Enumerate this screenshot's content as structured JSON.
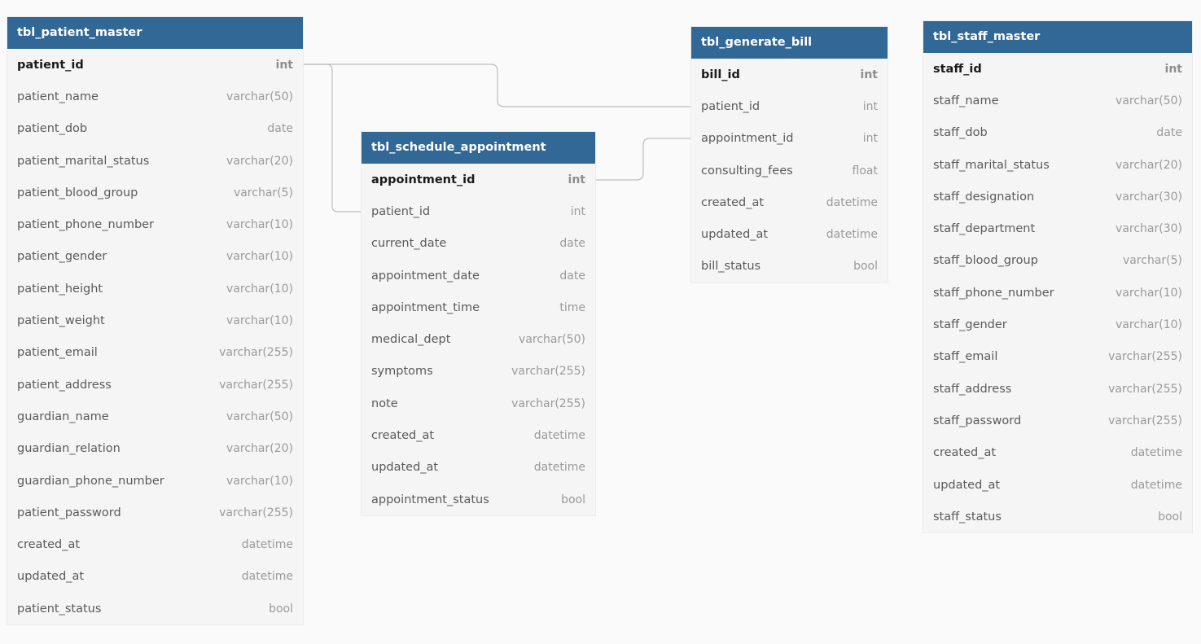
{
  "tables": {
    "patient": {
      "name": "tbl_patient_master",
      "columns": [
        {
          "name": "patient_id",
          "type": "int",
          "pk": true
        },
        {
          "name": "patient_name",
          "type": "varchar(50)"
        },
        {
          "name": "patient_dob",
          "type": "date"
        },
        {
          "name": "patient_marital_status",
          "type": "varchar(20)"
        },
        {
          "name": "patient_blood_group",
          "type": "varchar(5)"
        },
        {
          "name": "patient_phone_number",
          "type": "varchar(10)"
        },
        {
          "name": "patient_gender",
          "type": "varchar(10)"
        },
        {
          "name": "patient_height",
          "type": "varchar(10)"
        },
        {
          "name": "patient_weight",
          "type": "varchar(10)"
        },
        {
          "name": "patient_email",
          "type": "varchar(255)"
        },
        {
          "name": "patient_address",
          "type": "varchar(255)"
        },
        {
          "name": "guardian_name",
          "type": "varchar(50)"
        },
        {
          "name": "guardian_relation",
          "type": "varchar(20)"
        },
        {
          "name": "guardian_phone_number",
          "type": "varchar(10)"
        },
        {
          "name": "patient_password",
          "type": "varchar(255)"
        },
        {
          "name": "created_at",
          "type": "datetime"
        },
        {
          "name": "updated_at",
          "type": "datetime"
        },
        {
          "name": "patient_status",
          "type": "bool"
        }
      ]
    },
    "appointment": {
      "name": "tbl_schedule_appointment",
      "columns": [
        {
          "name": "appointment_id",
          "type": "int",
          "pk": true
        },
        {
          "name": "patient_id",
          "type": "int"
        },
        {
          "name": "current_date",
          "type": "date"
        },
        {
          "name": "appointment_date",
          "type": "date"
        },
        {
          "name": "appointment_time",
          "type": "time"
        },
        {
          "name": "medical_dept",
          "type": "varchar(50)"
        },
        {
          "name": "symptoms",
          "type": "varchar(255)"
        },
        {
          "name": "note",
          "type": "varchar(255)"
        },
        {
          "name": "created_at",
          "type": "datetime"
        },
        {
          "name": "updated_at",
          "type": "datetime"
        },
        {
          "name": "appointment_status",
          "type": "bool"
        }
      ]
    },
    "bill": {
      "name": "tbl_generate_bill",
      "columns": [
        {
          "name": "bill_id",
          "type": "int",
          "pk": true
        },
        {
          "name": "patient_id",
          "type": "int"
        },
        {
          "name": "appointment_id",
          "type": "int"
        },
        {
          "name": "consulting_fees",
          "type": "float"
        },
        {
          "name": "created_at",
          "type": "datetime"
        },
        {
          "name": "updated_at",
          "type": "datetime"
        },
        {
          "name": "bill_status",
          "type": "bool"
        }
      ]
    },
    "staff": {
      "name": "tbl_staff_master",
      "columns": [
        {
          "name": "staff_id",
          "type": "int",
          "pk": true
        },
        {
          "name": "staff_name",
          "type": "varchar(50)"
        },
        {
          "name": "staff_dob",
          "type": "date"
        },
        {
          "name": "staff_marital_status",
          "type": "varchar(20)"
        },
        {
          "name": "staff_designation",
          "type": "varchar(30)"
        },
        {
          "name": "staff_department",
          "type": "varchar(30)"
        },
        {
          "name": "staff_blood_group",
          "type": "varchar(5)"
        },
        {
          "name": "staff_phone_number",
          "type": "varchar(10)"
        },
        {
          "name": "staff_gender",
          "type": "varchar(10)"
        },
        {
          "name": "staff_email",
          "type": "varchar(255)"
        },
        {
          "name": "staff_address",
          "type": "varchar(255)"
        },
        {
          "name": "staff_password",
          "type": "varchar(255)"
        },
        {
          "name": "created_at",
          "type": "datetime"
        },
        {
          "name": "updated_at",
          "type": "datetime"
        },
        {
          "name": "staff_status",
          "type": "bool"
        }
      ]
    }
  },
  "relations": [
    {
      "from": "tbl_patient_master.patient_id",
      "to": "tbl_schedule_appointment.patient_id"
    },
    {
      "from": "tbl_patient_master.patient_id",
      "to": "tbl_generate_bill.patient_id"
    },
    {
      "from": "tbl_schedule_appointment.appointment_id",
      "to": "tbl_generate_bill.appointment_id"
    }
  ]
}
